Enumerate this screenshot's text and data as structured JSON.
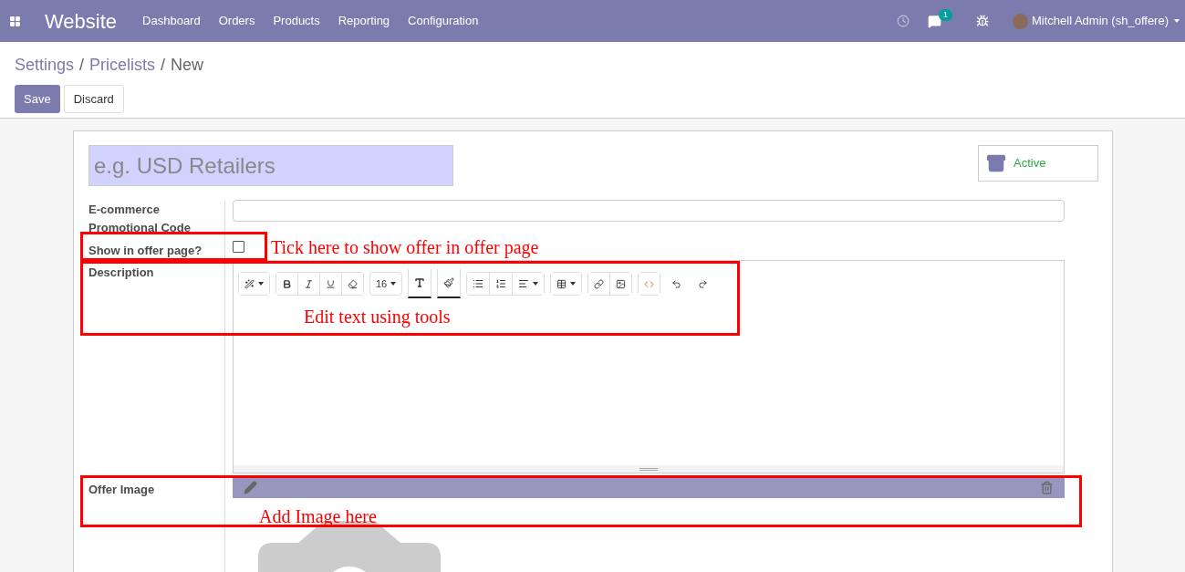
{
  "navbar": {
    "app_name": "Website",
    "menu": [
      "Dashboard",
      "Orders",
      "Products",
      "Reporting",
      "Configuration"
    ],
    "chat_badge": "1",
    "user": "Mitchell Admin (sh_offere)"
  },
  "breadcrumb": [
    {
      "label": "Settings",
      "link": true
    },
    {
      "label": "/",
      "link": false
    },
    {
      "label": "Pricelists",
      "link": true
    },
    {
      "label": "/",
      "link": false
    },
    {
      "label": "New",
      "link": false
    }
  ],
  "buttons": [
    {
      "label": "Save",
      "kind": "primary"
    },
    {
      "label": "Discard",
      "kind": "secondary"
    }
  ],
  "form": {
    "name_placeholder": "e.g. USD Retailers",
    "active_label": "Active",
    "fields": [
      {
        "label": "E-commerce Promotional Code",
        "kind": "text"
      },
      {
        "label": "Show in offer page?",
        "kind": "checkbox",
        "checked": false
      },
      {
        "label": "Description",
        "kind": "html",
        "font_size": "16"
      },
      {
        "label": "Offer Image",
        "kind": "image"
      }
    ]
  },
  "annotations": [
    {
      "text": "Tick here to show offer in offer page"
    },
    {
      "text": "Edit text using tools"
    },
    {
      "text": "Add Image here"
    }
  ]
}
